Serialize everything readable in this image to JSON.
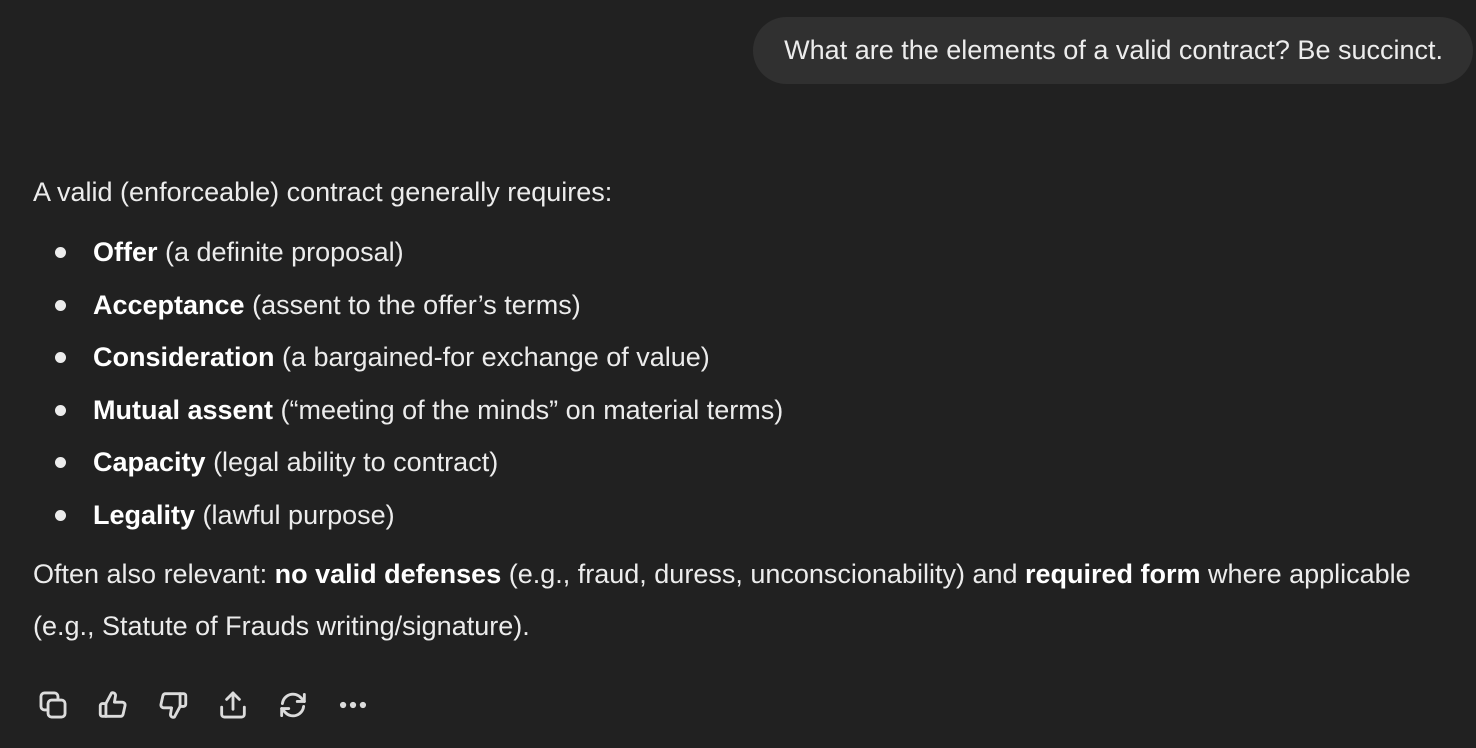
{
  "user_message": {
    "text": "What are the elements of a valid contract? Be succinct."
  },
  "assistant_message": {
    "intro": "A valid (enforceable) contract generally requires:",
    "elements": [
      {
        "term": "Offer",
        "desc": " (a definite proposal)"
      },
      {
        "term": "Acceptance",
        "desc": " (assent to the offer’s terms)"
      },
      {
        "term": "Consideration",
        "desc": " (a bargained-for exchange of value)"
      },
      {
        "term": "Mutual assent",
        "desc": " (“meeting of the minds” on material terms)"
      },
      {
        "term": "Capacity",
        "desc": " (legal ability to contract)"
      },
      {
        "term": "Legality",
        "desc": " (lawful purpose)"
      }
    ],
    "note": {
      "part1": "Often also relevant: ",
      "bold1": "no valid defenses",
      "part2": " (e.g., fraud, duress, unconscionability) and ",
      "bold2": "required form",
      "part3": " where applicable (e.g., Statute of Frauds writing/signature)."
    }
  },
  "actions": {
    "icons": [
      "copy-icon",
      "thumbs-up-icon",
      "thumbs-down-icon",
      "share-icon",
      "regenerate-icon",
      "more-icon"
    ]
  },
  "colors": {
    "background": "#212121",
    "user_bubble": "#303030",
    "text": "#ececec"
  }
}
